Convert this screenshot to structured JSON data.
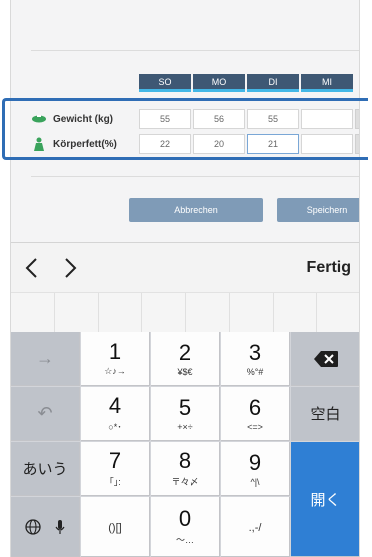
{
  "schedule": {
    "days": [
      "SO",
      "MO",
      "DI",
      "MI"
    ],
    "rows": [
      {
        "label": "Gewicht (kg)",
        "icon": "scale-icon",
        "values": [
          "55",
          "56",
          "55",
          ""
        ]
      },
      {
        "label": "Körperfett(%)",
        "icon": "body-fat-icon",
        "values": [
          "22",
          "20",
          "21",
          ""
        ]
      }
    ]
  },
  "buttons": {
    "cancel": "Abbrechen",
    "save": "Speichern"
  },
  "nav": {
    "done": "Fertig"
  },
  "keyboard": {
    "row1": {
      "k1": "1",
      "k1_sub": "☆♪→",
      "k2": "2",
      "k2_sub": "¥$€",
      "k3": "3",
      "k3_sub": "%°#"
    },
    "row2": {
      "k1": "4",
      "k1_sub": "○*･",
      "k2": "5",
      "k2_sub": "+×÷",
      "k3": "6",
      "k3_sub": "<=>",
      "space": "空白"
    },
    "row3": {
      "kana": "あいう",
      "k1": "7",
      "k1_sub": "｢｣:",
      "k2": "8",
      "k2_sub": "〒々〆",
      "k3": "9",
      "k3_sub": "^|\\",
      "open": "開く"
    },
    "row4": {
      "k1": "()[]",
      "k2": "0",
      "k2_sub": "〜…",
      "k3": ".,-/"
    }
  },
  "colors": {
    "header": "#3e5874",
    "accent_line": "#43b7e6",
    "highlight": "#2f6db5",
    "button": "#7f9bb7",
    "open_key": "#2f7fd4"
  }
}
